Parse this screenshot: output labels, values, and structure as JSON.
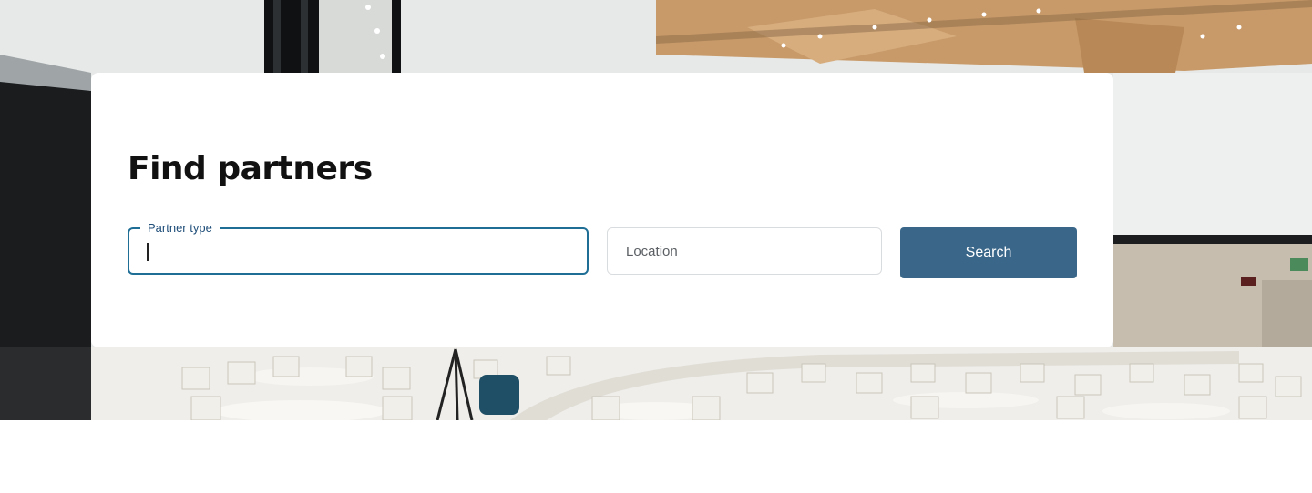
{
  "hero": {
    "image_icon": "conference-hall-photo",
    "colors": {
      "wall": "#e7e9e8",
      "ceiling_wood": "#c89a69",
      "floor": "#efeeea",
      "chairs": "#f4f3ef"
    }
  },
  "search_card": {
    "title": "Find partners",
    "partner_type": {
      "label": "Partner type",
      "value": ""
    },
    "location": {
      "placeholder": "Location",
      "value": ""
    },
    "search_label": "Search",
    "colors": {
      "accent": "#1e6e96",
      "button": "#3a6789",
      "label": "#1f4e79"
    }
  }
}
